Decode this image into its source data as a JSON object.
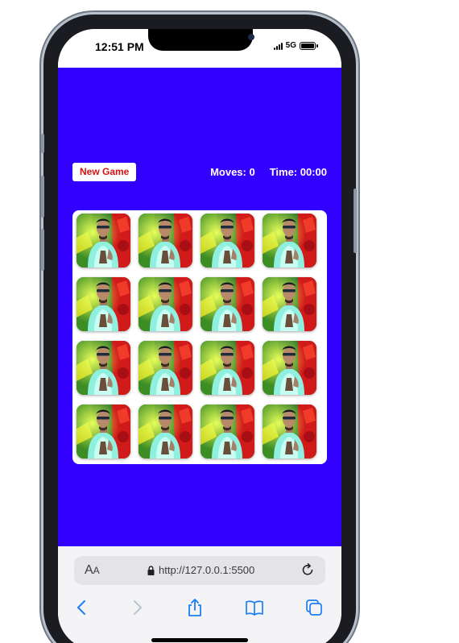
{
  "status_bar": {
    "time": "12:51 PM",
    "network": "5G"
  },
  "game": {
    "new_game_label": "New Game",
    "moves_label": "Moves: 0",
    "time_label": "Time: 00:00",
    "background_color": "#3200ff",
    "cards": [
      {
        "state": "face-down"
      },
      {
        "state": "face-down"
      },
      {
        "state": "face-down"
      },
      {
        "state": "face-down"
      },
      {
        "state": "face-down"
      },
      {
        "state": "face-down"
      },
      {
        "state": "face-down"
      },
      {
        "state": "face-down"
      },
      {
        "state": "face-down"
      },
      {
        "state": "face-down"
      },
      {
        "state": "face-down"
      },
      {
        "state": "face-down"
      },
      {
        "state": "face-down"
      },
      {
        "state": "face-down"
      },
      {
        "state": "face-down"
      },
      {
        "state": "face-down"
      }
    ]
  },
  "browser": {
    "text_size_label": "AA",
    "url": "http://127.0.0.1:5500",
    "icons": [
      "lock-icon",
      "reload-icon",
      "back-icon",
      "forward-icon",
      "share-icon",
      "bookmarks-icon",
      "tabs-icon"
    ]
  }
}
